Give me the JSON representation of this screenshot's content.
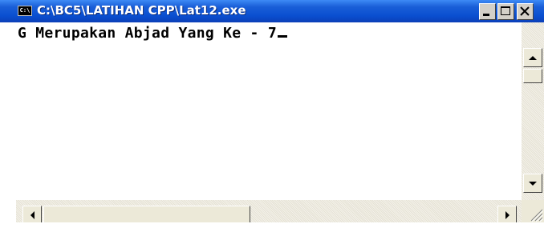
{
  "window": {
    "title": "C:\\BC5\\LATIHAN CPP\\Lat12.exe",
    "icon_label": "C:\\"
  },
  "console": {
    "output_line": "G Merupakan Abjad Yang Ke - 7"
  },
  "icons": {
    "app": "console-app-icon",
    "minimize": "minimize-icon",
    "maximize": "maximize-icon",
    "close": "close-icon",
    "scroll_up": "arrow-up-icon",
    "scroll_down": "arrow-down-icon",
    "scroll_left": "arrow-left-icon",
    "scroll_right": "arrow-right-icon",
    "resize_grip": "resize-grip-icon"
  },
  "colors": {
    "titlebar": "#0a4fd0",
    "console_bg": "#ffffff",
    "console_text": "#000000",
    "chrome": "#ece9d8"
  }
}
